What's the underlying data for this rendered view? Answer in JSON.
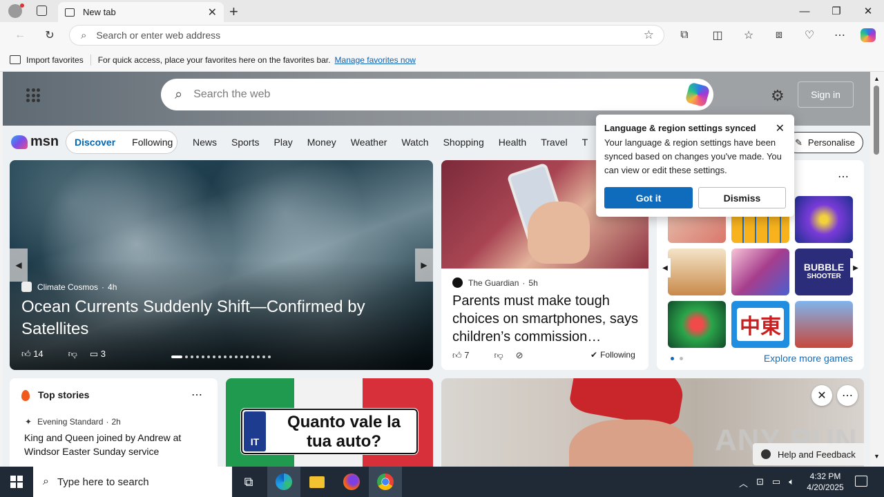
{
  "browser": {
    "tab_title": "New tab",
    "address_placeholder": "Search or enter web address",
    "favorites": {
      "import_label": "Import favorites",
      "hint": "For quick access, place your favorites here on the favorites bar.",
      "manage_link": "Manage favorites now"
    }
  },
  "msn": {
    "search_placeholder": "Search the web",
    "sign_in": "Sign in",
    "logo": "msn",
    "segments": [
      "Discover",
      "Following"
    ],
    "nav": [
      "News",
      "Sports",
      "Play",
      "Money",
      "Weather",
      "Watch",
      "Shopping",
      "Health",
      "Travel",
      "T"
    ],
    "personalise": "Personalise"
  },
  "hero_card": {
    "source": "Climate Cosmos",
    "age": "4h",
    "headline": "Ocean Currents Suddenly Shift—Confirmed by Satellites",
    "likes": "14",
    "comments": "3"
  },
  "guardian_card": {
    "source": "The Guardian",
    "age": "5h",
    "headline": "Parents must make tough choices on smartphones, says children’s commission…",
    "likes": "7",
    "following": "Following"
  },
  "games_card": {
    "explore": "Explore more games",
    "tile_names": [
      "BUBBLE",
      "SHOOTER",
      "中東"
    ]
  },
  "popup": {
    "title": "Language & region settings synced",
    "body": "Your language & region settings have been synced based on changes you've made. You can view or edit these settings.",
    "got_it": "Got it",
    "dismiss": "Dismiss"
  },
  "top_stories": {
    "title": "Top stories",
    "source": "Evening Standard",
    "age": "2h",
    "headline": "King and Queen joined by Andrew at Windsor Easter Sunday service"
  },
  "ad": {
    "text": "Quanto vale la tua auto?",
    "country": "IT"
  },
  "watermark": "ANY RUN",
  "help_feedback": "Help and Feedback",
  "taskbar": {
    "search_placeholder": "Type here to search",
    "time": "4:32 PM",
    "date": "4/20/2025"
  }
}
